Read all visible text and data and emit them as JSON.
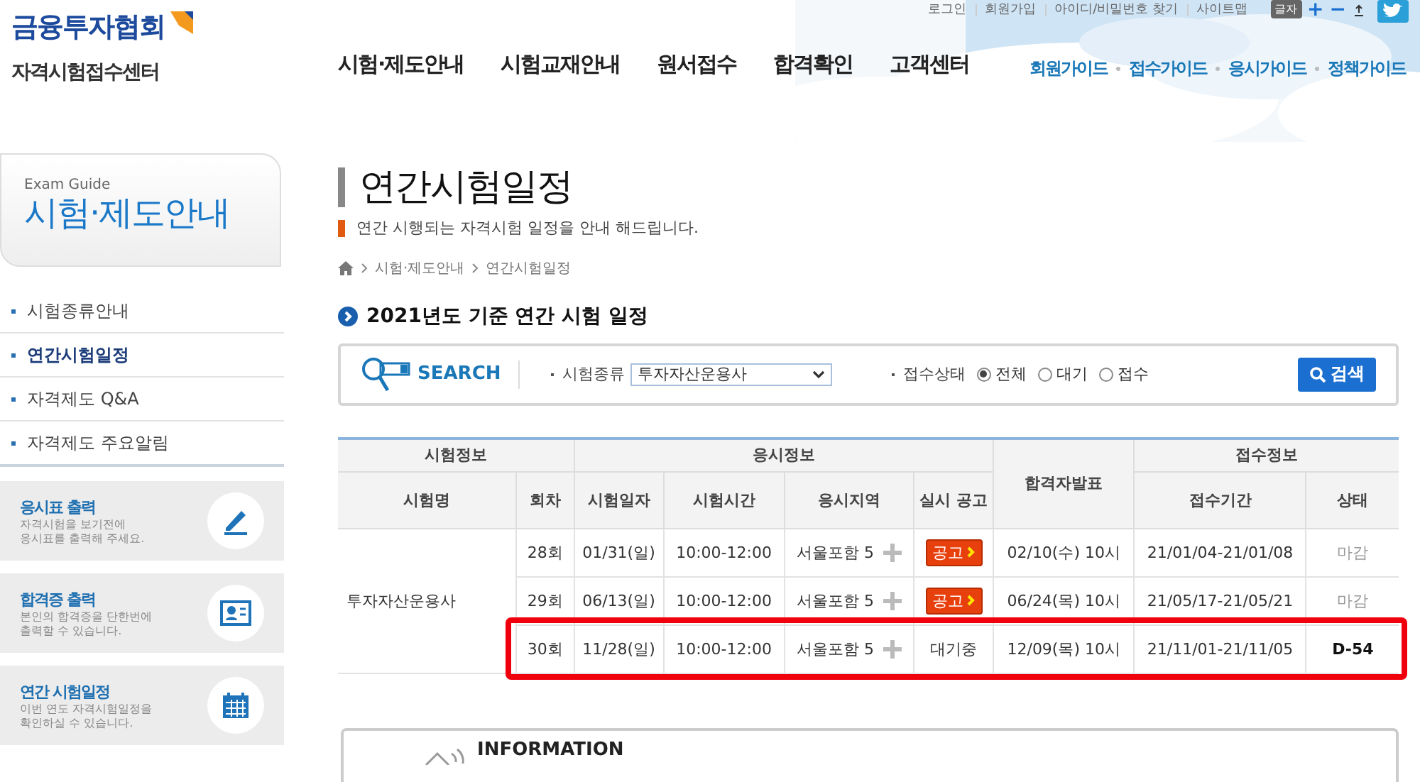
{
  "logo": {
    "name": "금융투자협회",
    "center": "자격시험접수센터"
  },
  "utility_links": [
    "로그인",
    "회원가입",
    "아이디/비밀번호 찾기",
    "사이트맵"
  ],
  "font_controls": {
    "label": "글자",
    "buttons": [
      "+",
      "−"
    ]
  },
  "main_nav": [
    "시험·제도안내",
    "시험교재안내",
    "원서접수",
    "합격확인",
    "고객센터"
  ],
  "guide_links": [
    "회원가이드",
    "접수가이드",
    "응시가이드",
    "정책가이드"
  ],
  "sidebar": {
    "caption": "Exam Guide",
    "heading": "시험·제도안내",
    "items": [
      {
        "label": "시험종류안내",
        "selected": false
      },
      {
        "label": "연간시험일정",
        "selected": true
      },
      {
        "label": "자격제도 Q&A",
        "selected": false
      },
      {
        "label": "자격제도 주요알림",
        "selected": false
      }
    ],
    "shortcuts": [
      {
        "title": "응시표 출력",
        "lines": [
          "자격시험을 보기전에",
          "응시표를 출력해 주세요."
        ],
        "kind": "pen"
      },
      {
        "title": "합격증 출력",
        "lines": [
          "본인의 합격증을 단한번에",
          "출력할 수 있습니다."
        ],
        "kind": "card"
      },
      {
        "title": "연간 시험일정",
        "lines": [
          "이번 연도 자격시험일정을",
          "확인하실 수 있습니다."
        ],
        "kind": "calendar"
      }
    ]
  },
  "page": {
    "title": "연간시험일정",
    "subtitle": "연간 시행되는 자격시험 일정을 안내 해드립니다.",
    "breadcrumb": [
      "시험·제도안내",
      "연간시험일정"
    ],
    "section_title": "2021년도 기준 연간 시험 일정"
  },
  "search": {
    "label": "SEARCH",
    "exam_type_label": "시험종류",
    "exam_type_value": "투자자산운용사",
    "status_label": "접수상태",
    "status_options": [
      {
        "label": "전체",
        "selected": true
      },
      {
        "label": "대기",
        "selected": false
      },
      {
        "label": "접수",
        "selected": false
      }
    ],
    "button": "검색"
  },
  "table": {
    "header_groups": [
      {
        "label": "시험정보",
        "columns": [
          "시험명",
          "회차"
        ]
      },
      {
        "label": "응시정보",
        "columns": [
          "시험일자",
          "시험시간",
          "응시지역",
          "실시 공고"
        ]
      },
      {
        "label": "합격자발표"
      },
      {
        "label": "접수정보",
        "columns": [
          "접수기간",
          "상태"
        ]
      }
    ],
    "groups": [
      {
        "exam_name": "투자자산운용사",
        "rows": [
          {
            "round": "28회",
            "date": "01/31(일)",
            "time": "10:00-12:00",
            "region": "서울포함 5",
            "notice": {
              "kind": "button",
              "label": "공고"
            },
            "result_date": "02/10(수) 10시",
            "period": "21/01/04-21/01/08",
            "status": "마감",
            "open": false,
            "highlighted": false
          },
          {
            "round": "29회",
            "date": "06/13(일)",
            "time": "10:00-12:00",
            "region": "서울포함 5",
            "notice": {
              "kind": "button",
              "label": "공고"
            },
            "result_date": "06/24(목) 10시",
            "period": "21/05/17-21/05/21",
            "status": "마감",
            "open": false,
            "highlighted": false
          },
          {
            "round": "30회",
            "date": "11/28(일)",
            "time": "10:00-12:00",
            "region": "서울포함 5",
            "notice": {
              "kind": "text",
              "label": "대기중"
            },
            "result_date": "12/09(목) 10시",
            "period": "21/11/01-21/11/05",
            "status": "D-54",
            "open": true,
            "highlighted": true
          }
        ]
      }
    ]
  },
  "information": {
    "title": "INFORMATION"
  }
}
